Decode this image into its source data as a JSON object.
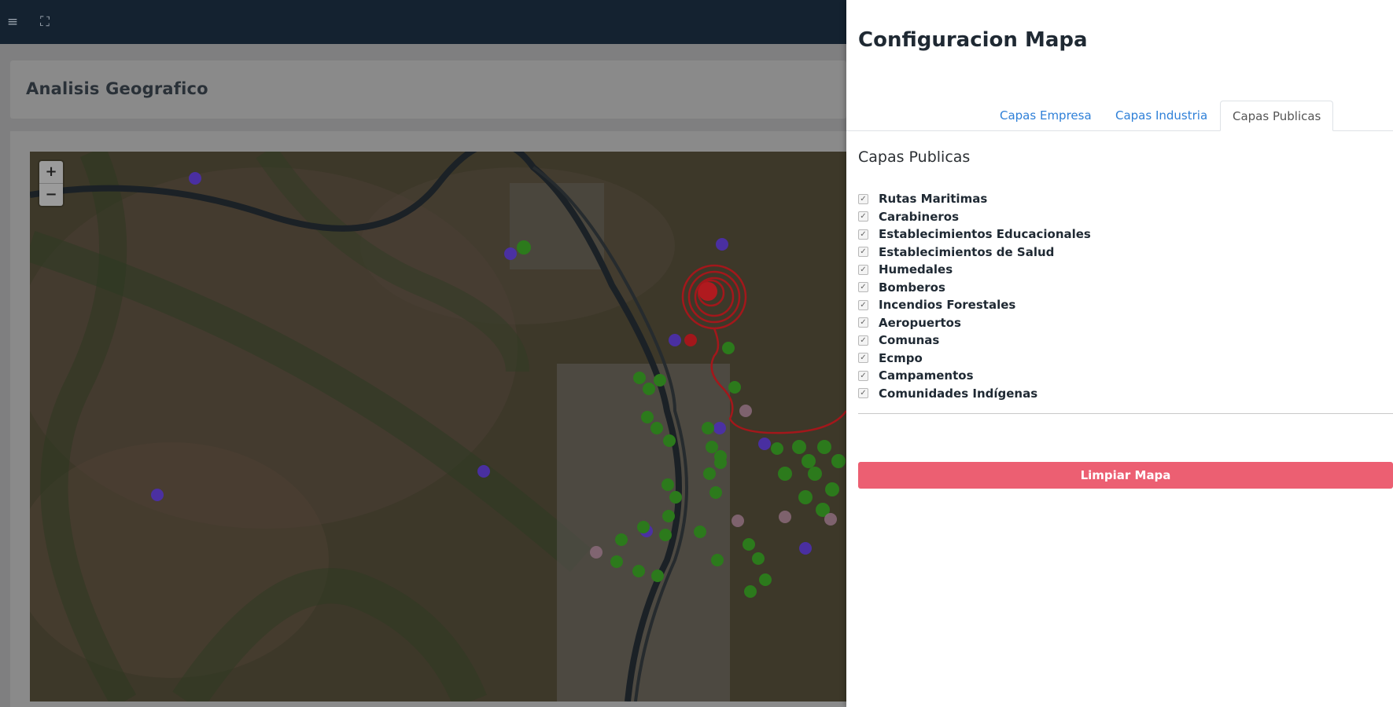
{
  "topbar": {
    "menu_icon": "hamburger-menu-icon",
    "fullscreen_icon": "fullscreen-icon"
  },
  "page": {
    "title": "Analisis Geografico"
  },
  "map": {
    "zoom_in": "+",
    "zoom_out": "−"
  },
  "panel": {
    "title": "Configuracion Mapa",
    "tabs": [
      {
        "label": "Capas Empresa",
        "active": false
      },
      {
        "label": "Capas Industria",
        "active": false
      },
      {
        "label": "Capas Publicas",
        "active": true
      }
    ],
    "section_title": "Capas Publicas",
    "layers": [
      {
        "label": "Rutas Maritimas",
        "checked": true
      },
      {
        "label": "Carabineros",
        "checked": true
      },
      {
        "label": "Establecimientos Educacionales",
        "checked": true
      },
      {
        "label": "Establecimientos de Salud",
        "checked": true
      },
      {
        "label": "Humedales",
        "checked": true
      },
      {
        "label": "Bomberos",
        "checked": true
      },
      {
        "label": "Incendios Forestales",
        "checked": true
      },
      {
        "label": "Aeropuertos",
        "checked": true
      },
      {
        "label": "Comunas",
        "checked": true
      },
      {
        "label": "Ecmpo",
        "checked": true
      },
      {
        "label": "Campamentos",
        "checked": true
      },
      {
        "label": "Comunidades Indígenas",
        "checked": true
      }
    ],
    "clear_button": "Limpiar Mapa"
  },
  "colors": {
    "accent": "#2f80d8",
    "danger": "#ec5f72",
    "topbar": "#142230"
  }
}
